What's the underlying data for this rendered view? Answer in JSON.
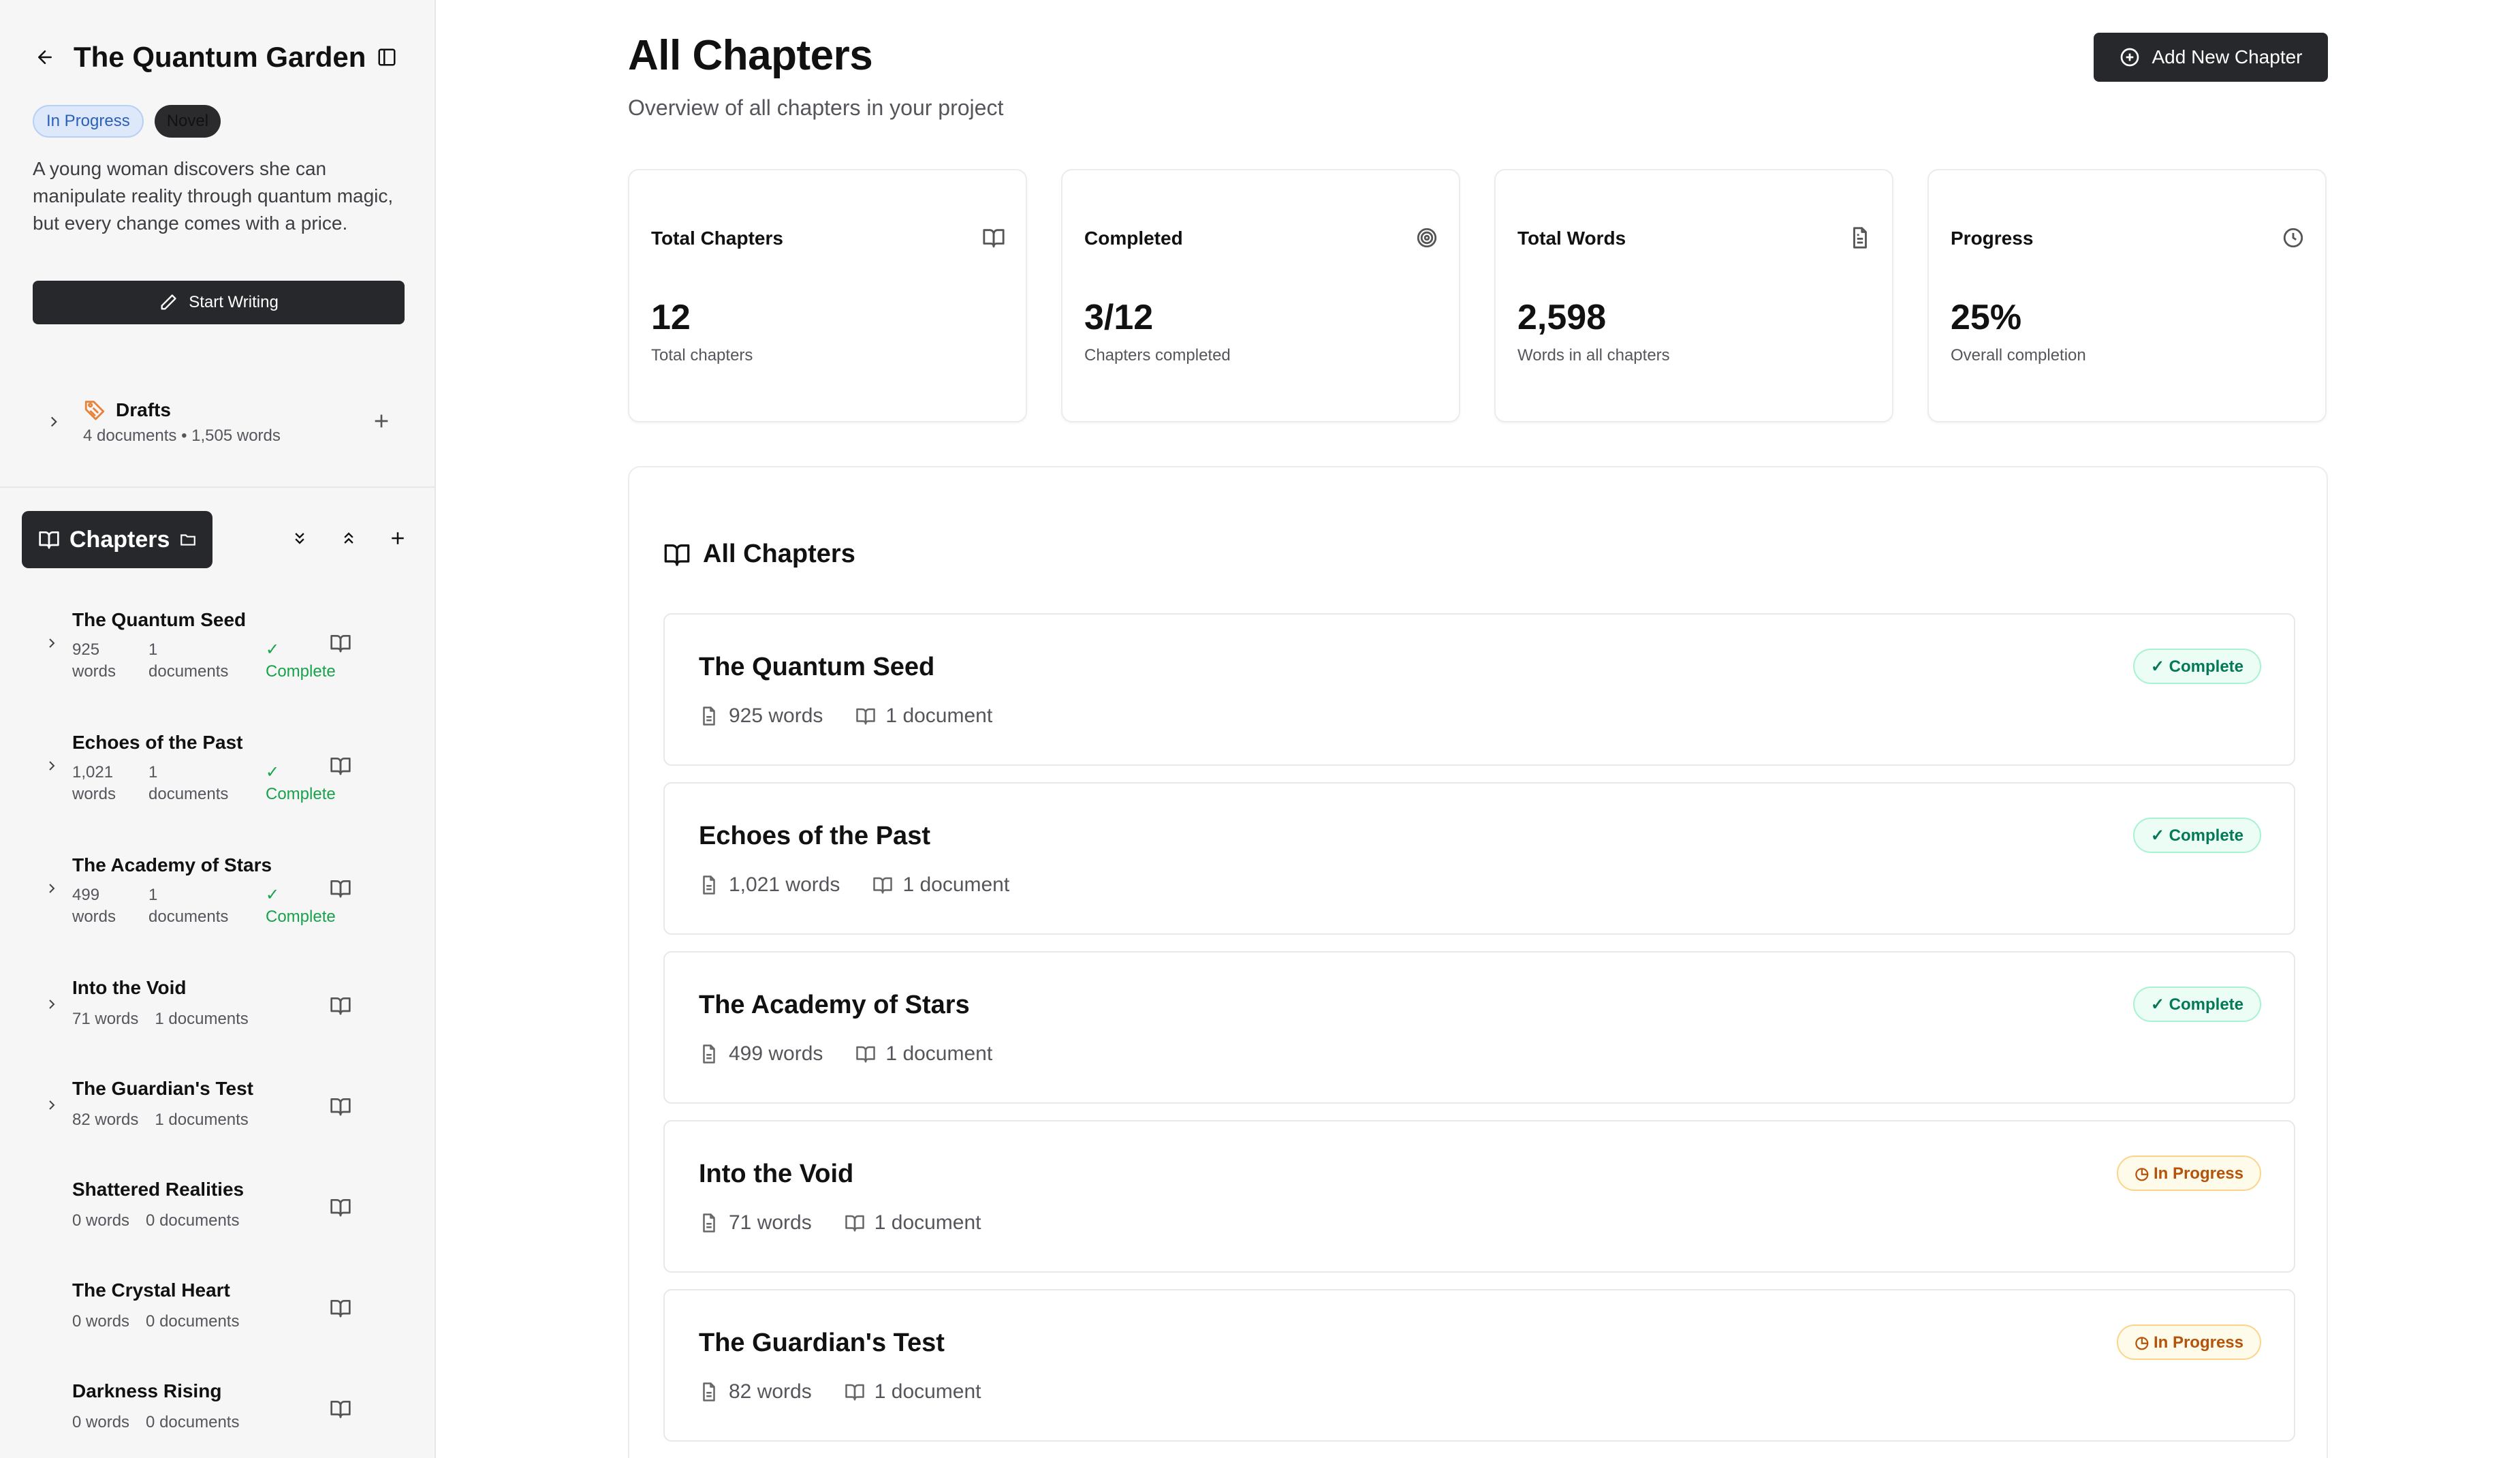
{
  "sidebar": {
    "project_title": "The Quantum Garden",
    "status_badge": "In Progress",
    "genre_badge": "Novel",
    "synopsis": "A young woman discovers she can manipulate reality through quantum magic, but every change comes with a price.",
    "start_writing": "Start Writing",
    "drafts": {
      "title": "Drafts",
      "meta": "4 documents • 1,505 words"
    },
    "chapters_label": "Chapters",
    "chapters": [
      {
        "name": "The Quantum Seed",
        "words": "925 words",
        "docs": "1 documents",
        "status": "✓ Complete"
      },
      {
        "name": "Echoes of the Past",
        "words": "1,021 words",
        "docs": "1 documents",
        "status": "✓ Complete"
      },
      {
        "name": "The Academy of Stars",
        "words": "499 words",
        "docs": "1 documents",
        "status": "✓ Complete"
      },
      {
        "name": "Into the Void",
        "words": "71 words",
        "docs": "1 documents",
        "status": ""
      },
      {
        "name": "The Guardian's Test",
        "words": "82 words",
        "docs": "1 documents",
        "status": ""
      },
      {
        "name": "Shattered Realities",
        "words": "0 words",
        "docs": "0 documents",
        "status": ""
      },
      {
        "name": "The Crystal Heart",
        "words": "0 words",
        "docs": "0 documents",
        "status": ""
      },
      {
        "name": "Darkness Rising",
        "words": "0 words",
        "docs": "0 documents",
        "status": ""
      }
    ]
  },
  "main": {
    "title": "All Chapters",
    "subtitle": "Overview of all chapters in your project",
    "add_button": "Add New Chapter",
    "stats": [
      {
        "label": "Total Chapters",
        "value": "12",
        "caption": "Total chapters",
        "icon": "book-open-icon"
      },
      {
        "label": "Completed",
        "value": "3/12",
        "caption": "Chapters completed",
        "icon": "target-icon"
      },
      {
        "label": "Total Words",
        "value": "2,598",
        "caption": "Words in all chapters",
        "icon": "file-text-icon"
      },
      {
        "label": "Progress",
        "value": "25%",
        "caption": "Overall completion",
        "icon": "clock-icon"
      }
    ],
    "list_title": "All Chapters",
    "rows": [
      {
        "title": "The Quantum Seed",
        "words": "925 words",
        "docs": "1 document",
        "status": "✓ Complete"
      },
      {
        "title": "Echoes of the Past",
        "words": "1,021 words",
        "docs": "1 document",
        "status": "✓ Complete"
      },
      {
        "title": "The Academy of Stars",
        "words": "499 words",
        "docs": "1 document",
        "status": "✓ Complete"
      },
      {
        "title": "Into the Void",
        "words": "71 words",
        "docs": "1 document",
        "status": "◷ In Progress"
      },
      {
        "title": "The Guardian's Test",
        "words": "82 words",
        "docs": "1 document",
        "status": "◷ In Progress"
      }
    ]
  },
  "colors": {
    "dark": "#26282c",
    "complete": "#047857",
    "in_progress": "#b45309",
    "status_blue": "#2c5fb8"
  }
}
